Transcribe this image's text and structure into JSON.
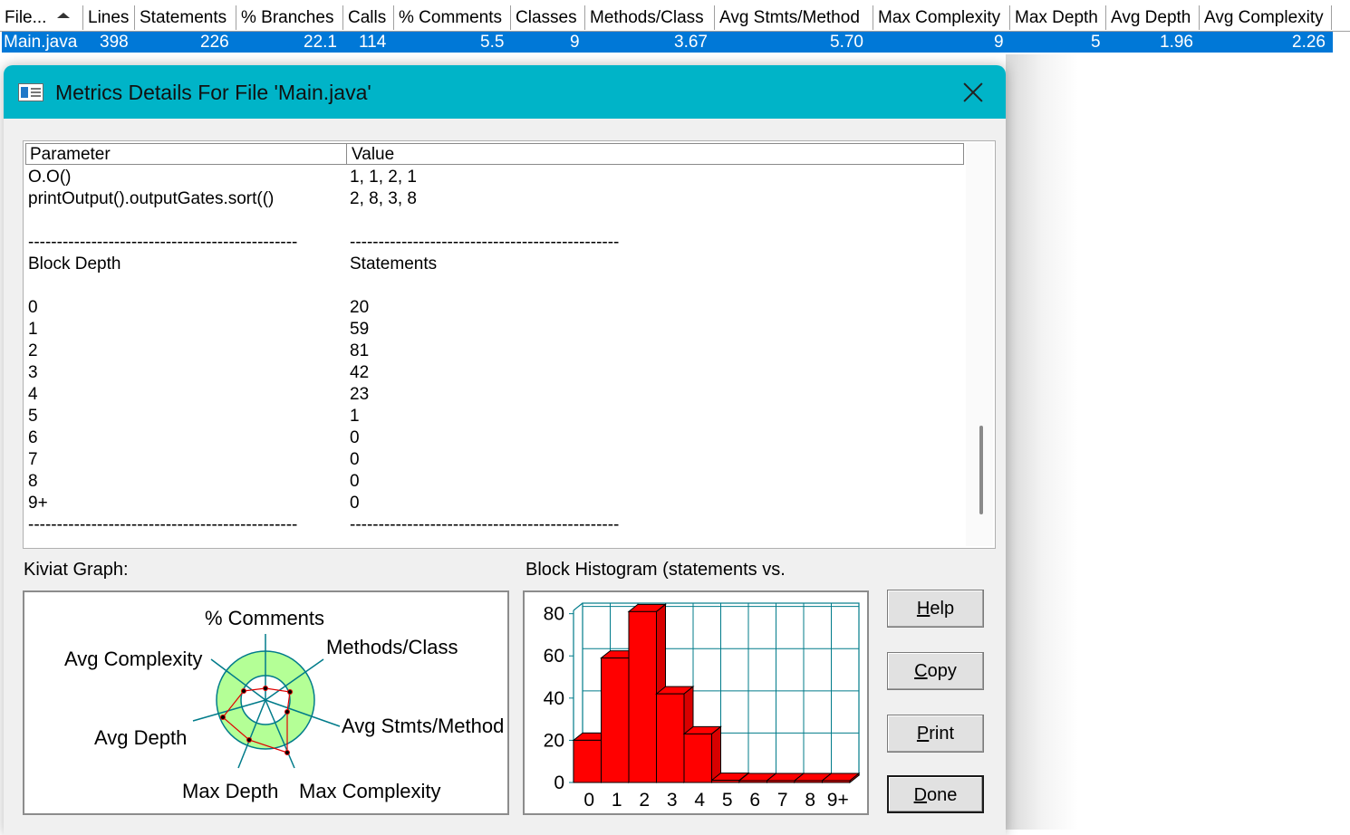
{
  "file_list": {
    "columns": [
      "File...",
      "Lines",
      "Statements",
      "% Branches",
      "Calls",
      "% Comments",
      "Classes",
      "Methods/Class",
      "Avg Stmts/Method",
      "Max Complexity",
      "Max Depth",
      "Avg Depth",
      "Avg Complexity"
    ],
    "row": [
      "Main.java",
      "398",
      "226",
      "22.1",
      "114",
      "5.5",
      "9",
      "3.67",
      "5.70",
      "9",
      "5",
      "1.96",
      "2.26"
    ]
  },
  "dialog": {
    "title": "Metrics Details For File 'Main.java'",
    "grid": {
      "headers": [
        "Parameter",
        "Value"
      ],
      "rows": [
        [
          "O.O()",
          "1, 1, 2, 1"
        ],
        [
          "printOutput().outputGates.sort(()",
          "2, 8, 3, 8"
        ],
        [
          "",
          ""
        ],
        [
          "-----------------------------------------------",
          "-----------------------------------------------"
        ],
        [
          "Block Depth",
          "Statements"
        ],
        [
          "",
          ""
        ],
        [
          "0",
          "20"
        ],
        [
          "1",
          "59"
        ],
        [
          "2",
          "81"
        ],
        [
          "3",
          "42"
        ],
        [
          "4",
          "23"
        ],
        [
          "5",
          "1"
        ],
        [
          "6",
          "0"
        ],
        [
          "7",
          "0"
        ],
        [
          "8",
          "0"
        ],
        [
          "9+",
          "0"
        ],
        [
          "-----------------------------------------------",
          "-----------------------------------------------"
        ]
      ]
    },
    "kiviat_label": "Kiviat Graph:",
    "histogram_label": "Block Histogram (statements vs.",
    "buttons": {
      "help": {
        "accel": "H",
        "rest": "elp"
      },
      "copy": {
        "accel": "C",
        "rest": "opy"
      },
      "print": {
        "accel": "P",
        "rest": "rint"
      },
      "done": {
        "accel": "D",
        "rest": "one"
      }
    }
  },
  "chart_data": [
    {
      "type": "radar",
      "axes": [
        "% Comments",
        "Methods/Class",
        "Avg Stmts/Method",
        "Max Complexity",
        "Max Depth",
        "Avg Depth",
        "Avg Complexity"
      ],
      "ring_colors": {
        "outer": "#b4ff96",
        "inner": "#ffffff",
        "spokes": "#007b8a",
        "polyline": "#e00000"
      }
    },
    {
      "type": "bar",
      "categories": [
        "0",
        "1",
        "2",
        "3",
        "4",
        "5",
        "6",
        "7",
        "8",
        "9+"
      ],
      "values": [
        20,
        59,
        81,
        42,
        23,
        1,
        0,
        0,
        0,
        0
      ],
      "yticks": [
        "0",
        "20",
        "40",
        "60",
        "80"
      ],
      "ylim": [
        0,
        85
      ],
      "bar_color": "#ff0000",
      "grid": true,
      "grid_color": "#007b8a"
    }
  ]
}
